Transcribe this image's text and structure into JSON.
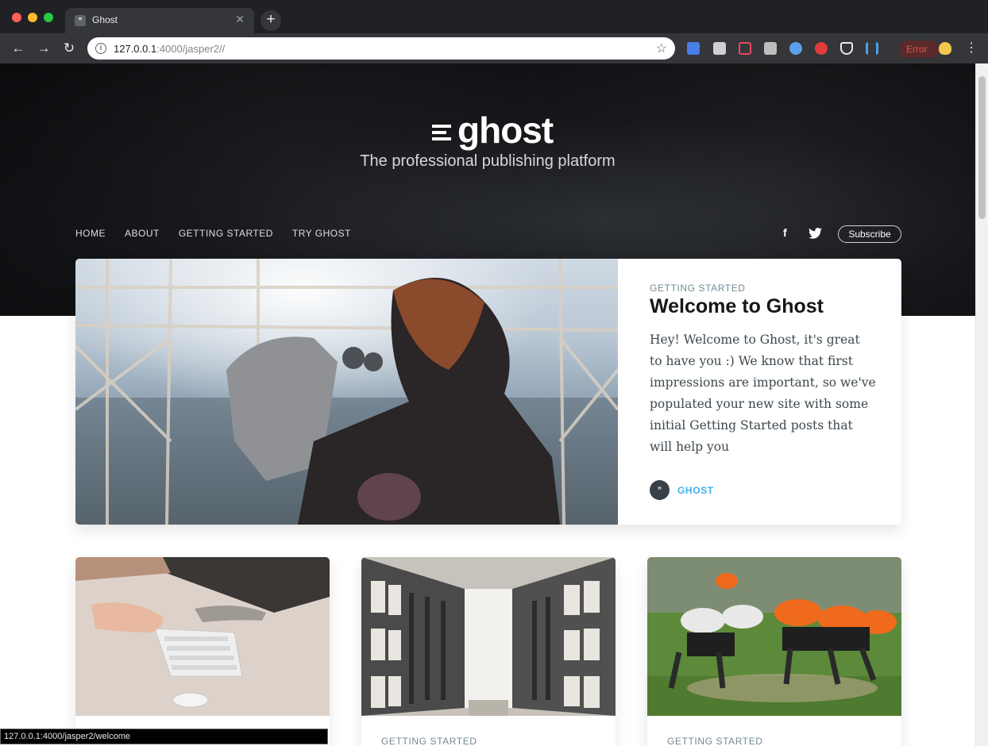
{
  "browser": {
    "tab_title": "Ghost",
    "favicon_text": "ꟸ",
    "url_host": "127.0.0.1",
    "url_rest": ":4000/jasper2//",
    "extension_error_label": "Error",
    "status_bar": "127.0.0.1:4000/jasper2/welcome"
  },
  "site": {
    "logo_text": "ghost",
    "tagline": "The professional publishing platform",
    "nav": [
      "HOME",
      "ABOUT",
      "GETTING STARTED",
      "TRY GHOST"
    ],
    "facebook_glyph": "f",
    "subscribe_label": "Subscribe"
  },
  "featured": {
    "tag": "GETTING STARTED",
    "title": "Welcome to Ghost",
    "excerpt": "Hey! Welcome to Ghost, it's great to have you :) We know that first impressions are important, so we've populated your new site with some initial Getting Started posts that will help you",
    "author": "GHOST",
    "avatar_text": "ꟸ"
  },
  "cards": [
    {
      "tag": ""
    },
    {
      "tag": "GETTING STARTED"
    },
    {
      "tag": "GETTING STARTED"
    }
  ],
  "colors": {
    "accent": "#3eb0ef",
    "hero_bg": "#141518",
    "tag_text": "#738a94"
  }
}
